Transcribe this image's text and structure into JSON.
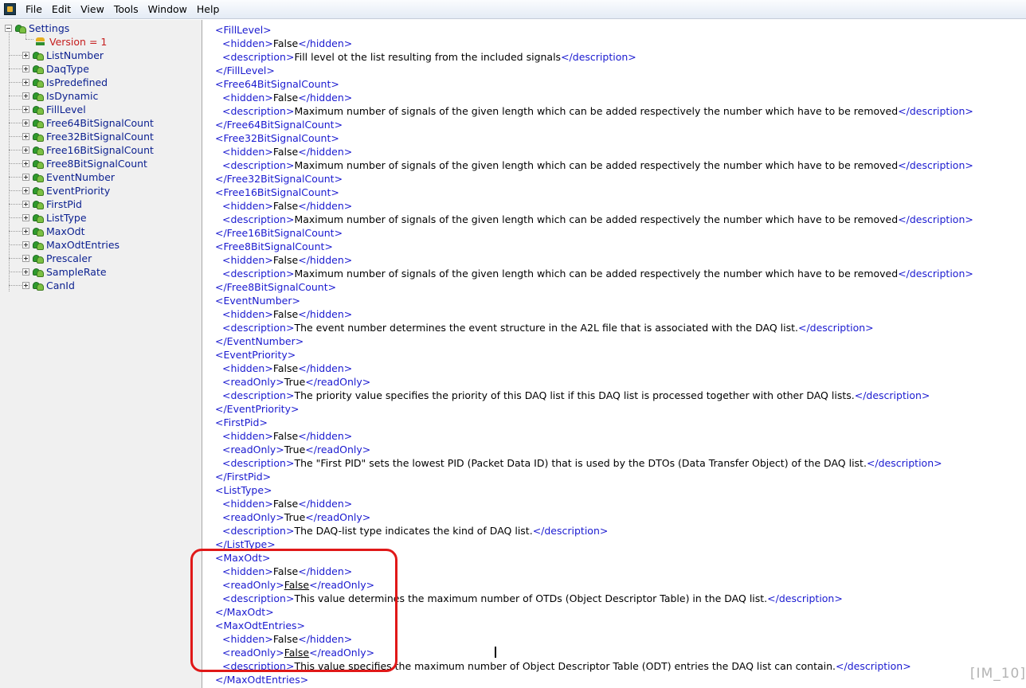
{
  "menubar": {
    "items": [
      "File",
      "Edit",
      "View",
      "Tools",
      "Window",
      "Help"
    ]
  },
  "tree": {
    "root": "Settings",
    "attribute": "Version = 1",
    "items": [
      "ListNumber",
      "DaqType",
      "IsPredefined",
      "IsDynamic",
      "FillLevel",
      "Free64BitSignalCount",
      "Free32BitSignalCount",
      "Free16BitSignalCount",
      "Free8BitSignalCount",
      "EventNumber",
      "EventPriority",
      "FirstPid",
      "ListType",
      "MaxOdt",
      "MaxOdtEntries",
      "Prescaler",
      "SampleRate",
      "CanId"
    ]
  },
  "xml_lines": [
    {
      "i": 0,
      "parts": [
        {
          "c": "tg",
          "t": "<FillLevel>"
        }
      ]
    },
    {
      "i": 1,
      "parts": [
        {
          "c": "tg",
          "t": "<hidden>"
        },
        {
          "c": "tx",
          "t": "False"
        },
        {
          "c": "tg",
          "t": "</hidden>"
        }
      ]
    },
    {
      "i": 1,
      "parts": [
        {
          "c": "tg",
          "t": "<description>"
        },
        {
          "c": "tx",
          "t": "Fill level ot the list resulting from the included signals"
        },
        {
          "c": "tg",
          "t": "</description>"
        }
      ]
    },
    {
      "i": 0,
      "parts": [
        {
          "c": "tg",
          "t": "</FillLevel>"
        }
      ]
    },
    {
      "i": 0,
      "parts": [
        {
          "c": "tg",
          "t": "<Free64BitSignalCount>"
        }
      ]
    },
    {
      "i": 1,
      "parts": [
        {
          "c": "tg",
          "t": "<hidden>"
        },
        {
          "c": "tx",
          "t": "False"
        },
        {
          "c": "tg",
          "t": "</hidden>"
        }
      ]
    },
    {
      "i": 1,
      "parts": [
        {
          "c": "tg",
          "t": "<description>"
        },
        {
          "c": "tx",
          "t": "Maximum number of signals of the given length which can be added respectively the number which have to be removed"
        },
        {
          "c": "tg",
          "t": "</description>"
        }
      ]
    },
    {
      "i": 0,
      "parts": [
        {
          "c": "tg",
          "t": "</Free64BitSignalCount>"
        }
      ]
    },
    {
      "i": 0,
      "parts": [
        {
          "c": "tg",
          "t": "<Free32BitSignalCount>"
        }
      ]
    },
    {
      "i": 1,
      "parts": [
        {
          "c": "tg",
          "t": "<hidden>"
        },
        {
          "c": "tx",
          "t": "False"
        },
        {
          "c": "tg",
          "t": "</hidden>"
        }
      ]
    },
    {
      "i": 1,
      "parts": [
        {
          "c": "tg",
          "t": "<description>"
        },
        {
          "c": "tx",
          "t": "Maximum number of signals of the given length which can be added respectively the number which have to be removed"
        },
        {
          "c": "tg",
          "t": "</description>"
        }
      ]
    },
    {
      "i": 0,
      "parts": [
        {
          "c": "tg",
          "t": "</Free32BitSignalCount>"
        }
      ]
    },
    {
      "i": 0,
      "parts": [
        {
          "c": "tg",
          "t": "<Free16BitSignalCount>"
        }
      ]
    },
    {
      "i": 1,
      "parts": [
        {
          "c": "tg",
          "t": "<hidden>"
        },
        {
          "c": "tx",
          "t": "False"
        },
        {
          "c": "tg",
          "t": "</hidden>"
        }
      ]
    },
    {
      "i": 1,
      "parts": [
        {
          "c": "tg",
          "t": "<description>"
        },
        {
          "c": "tx",
          "t": "Maximum number of signals of the given length which can be added respectively the number which have to be removed"
        },
        {
          "c": "tg",
          "t": "</description>"
        }
      ]
    },
    {
      "i": 0,
      "parts": [
        {
          "c": "tg",
          "t": "</Free16BitSignalCount>"
        }
      ]
    },
    {
      "i": 0,
      "parts": [
        {
          "c": "tg",
          "t": "<Free8BitSignalCount>"
        }
      ]
    },
    {
      "i": 1,
      "parts": [
        {
          "c": "tg",
          "t": "<hidden>"
        },
        {
          "c": "tx",
          "t": "False"
        },
        {
          "c": "tg",
          "t": "</hidden>"
        }
      ]
    },
    {
      "i": 1,
      "parts": [
        {
          "c": "tg",
          "t": "<description>"
        },
        {
          "c": "tx",
          "t": "Maximum number of signals of the given length which can be added respectively the number which have to be removed"
        },
        {
          "c": "tg",
          "t": "</description>"
        }
      ]
    },
    {
      "i": 0,
      "parts": [
        {
          "c": "tg",
          "t": "</Free8BitSignalCount>"
        }
      ]
    },
    {
      "i": 0,
      "parts": [
        {
          "c": "tg",
          "t": "<EventNumber>"
        }
      ]
    },
    {
      "i": 1,
      "parts": [
        {
          "c": "tg",
          "t": "<hidden>"
        },
        {
          "c": "tx",
          "t": "False"
        },
        {
          "c": "tg",
          "t": "</hidden>"
        }
      ]
    },
    {
      "i": 1,
      "parts": [
        {
          "c": "tg",
          "t": "<description>"
        },
        {
          "c": "tx",
          "t": "The event number determines the event structure in the A2L file that is associated with the DAQ list."
        },
        {
          "c": "tg",
          "t": "</description>"
        }
      ]
    },
    {
      "i": 0,
      "parts": [
        {
          "c": "tg",
          "t": "</EventNumber>"
        }
      ]
    },
    {
      "i": 0,
      "parts": [
        {
          "c": "tg",
          "t": "<EventPriority>"
        }
      ]
    },
    {
      "i": 1,
      "parts": [
        {
          "c": "tg",
          "t": "<hidden>"
        },
        {
          "c": "tx",
          "t": "False"
        },
        {
          "c": "tg",
          "t": "</hidden>"
        }
      ]
    },
    {
      "i": 1,
      "parts": [
        {
          "c": "tg",
          "t": "<readOnly>"
        },
        {
          "c": "tx",
          "t": "True"
        },
        {
          "c": "tg",
          "t": "</readOnly>"
        }
      ]
    },
    {
      "i": 1,
      "parts": [
        {
          "c": "tg",
          "t": "<description>"
        },
        {
          "c": "tx",
          "t": "The priority value specifies the priority of this DAQ list if this DAQ list is processed together with other DAQ lists."
        },
        {
          "c": "tg",
          "t": "</description>"
        }
      ]
    },
    {
      "i": 0,
      "parts": [
        {
          "c": "tg",
          "t": "</EventPriority>"
        }
      ]
    },
    {
      "i": 0,
      "parts": [
        {
          "c": "tg",
          "t": "<FirstPid>"
        }
      ]
    },
    {
      "i": 1,
      "parts": [
        {
          "c": "tg",
          "t": "<hidden>"
        },
        {
          "c": "tx",
          "t": "False"
        },
        {
          "c": "tg",
          "t": "</hidden>"
        }
      ]
    },
    {
      "i": 1,
      "parts": [
        {
          "c": "tg",
          "t": "<readOnly>"
        },
        {
          "c": "tx",
          "t": "True"
        },
        {
          "c": "tg",
          "t": "</readOnly>"
        }
      ]
    },
    {
      "i": 1,
      "parts": [
        {
          "c": "tg",
          "t": "<description>"
        },
        {
          "c": "tx",
          "t": "The \"First PID\" sets the lowest PID (Packet Data ID) that is used by the DTOs (Data Transfer Object) of the DAQ list."
        },
        {
          "c": "tg",
          "t": "</description>"
        }
      ]
    },
    {
      "i": 0,
      "parts": [
        {
          "c": "tg",
          "t": "</FirstPid>"
        }
      ]
    },
    {
      "i": 0,
      "parts": [
        {
          "c": "tg",
          "t": "<ListType>"
        }
      ]
    },
    {
      "i": 1,
      "parts": [
        {
          "c": "tg",
          "t": "<hidden>"
        },
        {
          "c": "tx",
          "t": "False"
        },
        {
          "c": "tg",
          "t": "</hidden>"
        }
      ]
    },
    {
      "i": 1,
      "parts": [
        {
          "c": "tg",
          "t": "<readOnly>"
        },
        {
          "c": "tx",
          "t": "True"
        },
        {
          "c": "tg",
          "t": "</readOnly>"
        }
      ]
    },
    {
      "i": 1,
      "parts": [
        {
          "c": "tg",
          "t": "<description>"
        },
        {
          "c": "tx",
          "t": "The DAQ-list type indicates the kind of DAQ list."
        },
        {
          "c": "tg",
          "t": "</description>"
        }
      ]
    },
    {
      "i": 0,
      "parts": [
        {
          "c": "tg",
          "t": "</ListType>"
        }
      ]
    },
    {
      "i": 0,
      "parts": [
        {
          "c": "tg",
          "t": "<MaxOdt>"
        }
      ]
    },
    {
      "i": 1,
      "parts": [
        {
          "c": "tg",
          "t": "<hidden>"
        },
        {
          "c": "tx",
          "t": "False"
        },
        {
          "c": "tg",
          "t": "</hidden>"
        }
      ]
    },
    {
      "i": 1,
      "parts": [
        {
          "c": "tg",
          "t": "<readOnly>"
        },
        {
          "c": "tx u",
          "t": "False"
        },
        {
          "c": "tg",
          "t": "</readOnly>"
        }
      ]
    },
    {
      "i": 1,
      "parts": [
        {
          "c": "tg",
          "t": "<description>"
        },
        {
          "c": "tx",
          "t": "This value determines the maximum number of OTDs (Object Descriptor Table) in the DAQ list."
        },
        {
          "c": "tg",
          "t": "</description>"
        }
      ]
    },
    {
      "i": 0,
      "parts": [
        {
          "c": "tg",
          "t": "</MaxOdt>"
        }
      ]
    },
    {
      "i": 0,
      "parts": [
        {
          "c": "tg",
          "t": "<MaxOdtEntries>"
        }
      ]
    },
    {
      "i": 1,
      "parts": [
        {
          "c": "tg",
          "t": "<hidden>"
        },
        {
          "c": "tx",
          "t": "False"
        },
        {
          "c": "tg",
          "t": "</hidden>"
        }
      ]
    },
    {
      "i": 1,
      "parts": [
        {
          "c": "tg",
          "t": "<readOnly>"
        },
        {
          "c": "tx u",
          "t": "False"
        },
        {
          "c": "tg",
          "t": "</readOnly>"
        }
      ]
    },
    {
      "i": 1,
      "parts": [
        {
          "c": "tg",
          "t": "<description>"
        },
        {
          "c": "tx",
          "t": "This value specifies the maximum number of Object Descriptor Table (ODT) entries the DAQ list can contain."
        },
        {
          "c": "tg",
          "t": "</description>"
        }
      ]
    },
    {
      "i": 0,
      "parts": [
        {
          "c": "tg",
          "t": "</MaxOdtEntries>"
        }
      ]
    }
  ],
  "watermark": "[IM_10]",
  "colors": {
    "tag": "#1a1ad0",
    "tree_label": "#0a1f8f",
    "attribute": "#c51d1d",
    "annotation": "#e01818"
  }
}
